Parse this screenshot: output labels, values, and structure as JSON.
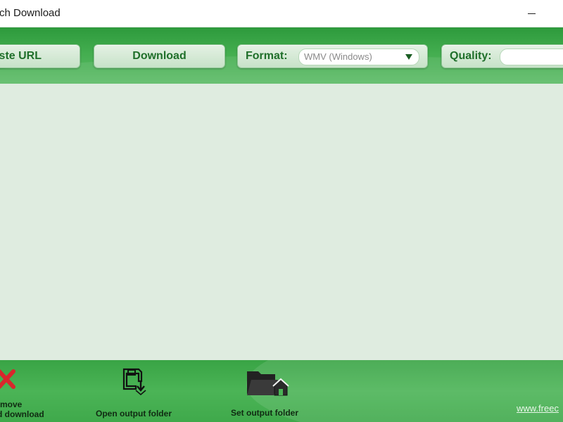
{
  "window": {
    "title": "ch Download",
    "minimize_glyph": ""
  },
  "toolbar": {
    "paste_url_label": "ste URL",
    "download_label": "Download",
    "format_label": "Format:",
    "format_value": "WMV (Windows)",
    "quality_label": "Quality:",
    "quality_value": ""
  },
  "list": {
    "items": []
  },
  "bottombar": {
    "remove_label_line1": "move",
    "remove_label_line2": "d download",
    "open_output_label": "Open output folder",
    "set_output_label": "Set output folder",
    "site_link": "www.freec"
  },
  "colors": {
    "toolbar_green": "#43ad4f",
    "list_background": "#dfece0",
    "button_text": "#1f6f2a",
    "remove_red": "#d9262c"
  },
  "icons": {
    "remove": "x-icon",
    "open_output": "save-disk-arrow-icon",
    "set_output": "folder-home-icon",
    "format_dropdown": "chevron-down-icon"
  }
}
